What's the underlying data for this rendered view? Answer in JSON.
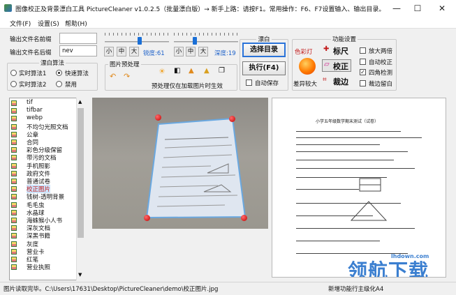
{
  "window": {
    "title": "图像校正及背景漂白工具 PictureCleaner v1.0.2.5（批量漂白版）→ 新手上路：请按F1。常用操作：F6、F7设置输入、输出目录。单击...",
    "minimize": "—",
    "maximize": "☐",
    "close": "✕"
  },
  "menu": [
    "文件(F)",
    "设置(S)",
    "帮助(H)"
  ],
  "output": {
    "prefix_label": "输出文件名前缀",
    "prefix_value": "",
    "suffix_label": "输出文件名后缀",
    "suffix_value": "nev"
  },
  "sliders": {
    "left": {
      "small": "小",
      "medium": "中",
      "large": "大",
      "caption": "锐度:61",
      "value": 61
    },
    "right": {
      "small": "小",
      "medium": "中",
      "large": "大",
      "caption": "深度:19",
      "value": 19
    }
  },
  "bleach_algo": {
    "title": "漂白算法",
    "options": [
      {
        "label": "实时算法1",
        "checked": false
      },
      {
        "label": "快速算法",
        "checked": true
      },
      {
        "label": "实时算法2",
        "checked": false
      },
      {
        "label": "禁用",
        "checked": false
      }
    ]
  },
  "preview": {
    "title": "图片预处理",
    "hint": "预处理仅在加载图片时生效"
  },
  "bleach_panel": {
    "title": "漂白",
    "select_dir": "选择目录",
    "execute": "执行(F4)",
    "auto_save": "自动保存",
    "auto_save_checked": false
  },
  "functions": {
    "title": "功能设置",
    "color_light": "色彩灯",
    "ruler": "标尺",
    "correct": "校正",
    "crop": "裁边",
    "diff_large": "差异较大",
    "enlarge_two_page": "放大两倍",
    "auto_correct": "自动校正",
    "border_detect": "四角检测",
    "crop_white": "裁边留白",
    "enlarge_checked": false,
    "auto_checked": false,
    "border_checked": true,
    "crop_white_checked": false
  },
  "file_list": [
    "tif",
    "tifbar",
    "webp",
    "不均匀光照文档",
    "公章",
    "合同",
    "彩色分级保留",
    "带污的文档",
    "手机照影",
    "政府文件",
    "普通试卷",
    "校正图片",
    "钱树-透明背景",
    "毛毛虫",
    "水晶球",
    "海蛛猴小人书",
    "深灰文档",
    "深黑书籍",
    "灰度",
    "营业卡",
    "红笔",
    "营业执照"
  ],
  "selected_index": 11,
  "status": {
    "left": "图片读取完毕。C:\\Users\\17631\\Desktop\\PictureCleaner\\demo\\校正图片.jpg",
    "right": "新增功能行主级化A4"
  },
  "watermark": {
    "url": "lhdown.com",
    "brand": "领航下载"
  },
  "doc_title": "小学五年级数学期末测试（试卷）",
  "colors": {
    "accent": "#1a6fd6",
    "red": "#c20000",
    "blue_label": "#1a5fc9"
  }
}
